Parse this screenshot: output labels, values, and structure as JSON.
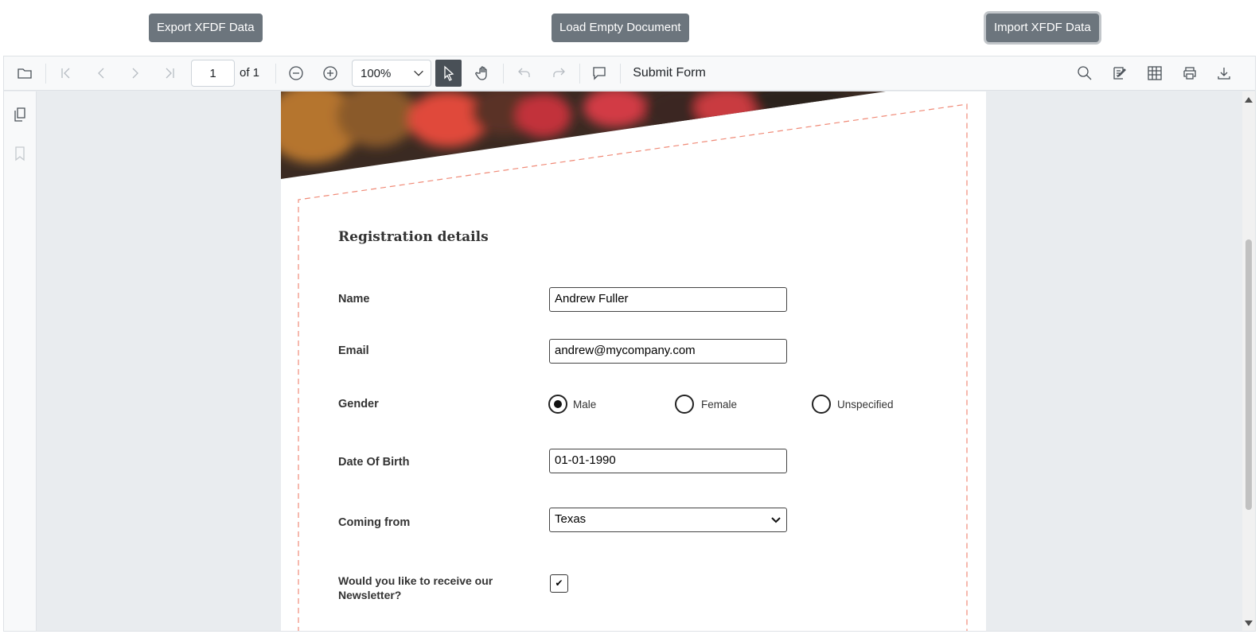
{
  "top_buttons": {
    "export_label": "Export XFDF Data",
    "load_label": "Load Empty Document",
    "import_label": "Import XFDF Data"
  },
  "toolbar": {
    "page_number": "1",
    "page_total_label": "of 1",
    "zoom_value": "100%",
    "submit_label": "Submit Form"
  },
  "form": {
    "title": "Registration details",
    "name_label": "Name",
    "name_value": "Andrew Fuller",
    "email_label": "Email",
    "email_value": "andrew@mycompany.com",
    "gender_label": "Gender",
    "gender_options": [
      "Male",
      "Female",
      "Unspecified"
    ],
    "gender_selected": "Male",
    "dob_label": "Date Of Birth",
    "dob_value": "01-01-1990",
    "coming_from_label": "Coming from",
    "coming_from_value": "Texas",
    "newsletter_label_line1": "Would you like to receive our",
    "newsletter_label_line2": "Newsletter?",
    "newsletter_checked": true,
    "checkmark": "✔"
  },
  "colors": {
    "button_bg": "#6c757d",
    "dashed_border": "#f08a77",
    "active_tool_bg": "#495057"
  }
}
